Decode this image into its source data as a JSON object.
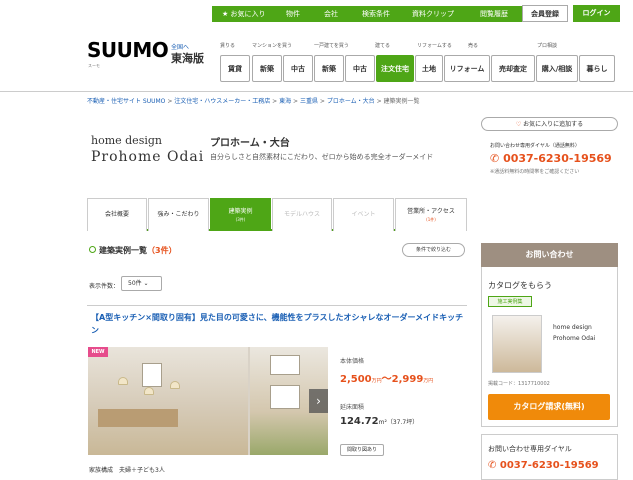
{
  "topbar": {
    "favorites": "★ お気に入り",
    "properties": "物件",
    "companies": "会社",
    "search_history": "検索条件",
    "clips": "資料クリップ",
    "history": "閲覧履歴",
    "register": "会員登録",
    "login": "ログイン"
  },
  "header": {
    "logo": "SUUMO",
    "logo_sub": "スーモ",
    "region_link": "全国へ",
    "region": "東海版",
    "categories": [
      "賃りる",
      "マンションを買う",
      "一戸建てを買う",
      "建てる",
      "リフォームする",
      "売る",
      "プロ相談"
    ],
    "nav": [
      "賃貸",
      "新築",
      "中古",
      "新築",
      "中古",
      "注文住宅",
      "土地",
      "リフォーム",
      "売却査定",
      "購入/相談",
      "暮らし"
    ]
  },
  "breadcrumb": {
    "items": [
      "不動産・住宅サイト SUUMO",
      "注文住宅・ハウスメーカー・工務店",
      "東海",
      "三重県",
      "プロホーム・大台",
      "建築実例一覧"
    ],
    "sep": " > "
  },
  "store": {
    "en_line1": "home design",
    "en_line2": "Prohome  Odai",
    "name": "プロホーム・大台",
    "catch": "自分らしさと自然素材にこだわり、ゼロから始める完全オーダーメイド",
    "fav_button": "お気に入りに追加する",
    "contact_label": "お問い合わせ専用ダイヤル（通話無料）",
    "phone": "0037-6230-19569",
    "phone_note": "※通話料無料の時間帯をご確認ください"
  },
  "tabs": [
    {
      "label": "会社概要",
      "sub": ""
    },
    {
      "label": "強み・こだわり",
      "sub": ""
    },
    {
      "label": "建築実例",
      "sub": "(3件)"
    },
    {
      "label": "モデルハウス",
      "sub": ""
    },
    {
      "label": "イベント",
      "sub": ""
    },
    {
      "label": "営業所・アクセス",
      "sub": "(1件)"
    }
  ],
  "section": {
    "title": "建築実例一覧",
    "count": "（3件）",
    "filter_button": "条件で絞り込む",
    "per_page_label": "表示件数：",
    "per_page_value": "50件 ⌄"
  },
  "case": {
    "title": "【A型キッチン×間取り固有】見た目の可愛さに、機能性をプラスしたオシャレなオーダーメイドキッチン",
    "new_badge": "NEW",
    "price_label": "本体価格",
    "price_min": "2,500",
    "price_max": "2,999",
    "price_unit": "万円",
    "price_sep": "〜",
    "area_label": "延床面積",
    "area_value": "124.72",
    "area_unit": "m²",
    "area_tsubo": "（37.7坪）",
    "tag_button": "間取り図あり",
    "family_label": "家族構成",
    "family_value": "夫婦＋子ども3人"
  },
  "sidebar": {
    "head": "お問い合わせ",
    "catalog_title": "カタログをもらう",
    "catalog_tag": "施工実例集",
    "catalog_name": "home design Prohome Odai",
    "catalog_code": "掲載コード：1317710002",
    "catalog_button": "カタログ請求(無料)",
    "dial_title": "お問い合わせ専用ダイヤル",
    "dial_phone": "0037-6230-19569"
  },
  "colors": {
    "brand_green": "#4ea616",
    "accent_orange": "#e6511c",
    "catalog_orange": "#f08a0a",
    "link_blue": "#1a5fb4"
  }
}
